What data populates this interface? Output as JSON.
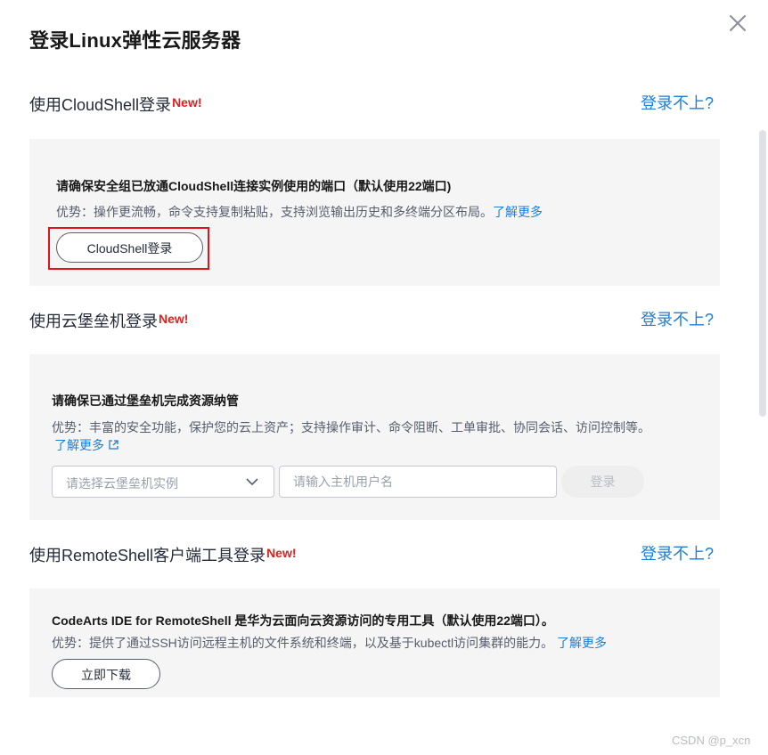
{
  "dialog": {
    "title": "登录Linux弹性云服务器"
  },
  "new_tag": "New!",
  "help_link": "登录不上?",
  "cloudshell": {
    "section_title": "使用CloudShell登录",
    "heading": "请确保安全组已放通CloudShell连接实例使用的端口（默认使用22端口)",
    "desc": "优势：操作更流畅，命令支持复制粘贴，支持浏览输出历史和多终端分区布局。",
    "learn_more": "了解更多",
    "button_label": "CloudShell登录"
  },
  "bastion": {
    "section_title": "使用云堡垒机登录",
    "heading": "请确保已通过堡垒机完成资源纳管",
    "desc": "优势：丰富的安全功能，保护您的云上资产；支持操作审计、命令阻断、工单审批、协同会话、访问控制等。",
    "learn_more": "了解更多",
    "select_placeholder": "请选择云堡垒机实例",
    "input_placeholder": "请输入主机用户名",
    "login_button": "登录"
  },
  "remoteshell": {
    "section_title": "使用RemoteShell客户端工具登录",
    "heading": "CodeArts IDE for RemoteShell 是华为云面向云资源访问的专用工具（默认使用22端口）。",
    "desc": "优势：提供了通过SSH访问远程主机的文件系统和终端，以及基于kubectl访问集群的能力。",
    "learn_more": "了解更多",
    "download_button": "立即下载"
  },
  "watermark": "CSDN @p_xcn",
  "colors": {
    "link": "#1e7fd6",
    "new_tag": "#e02020",
    "highlight": "#e0131b",
    "panel_bg": "#f5f5f6"
  },
  "icons": {
    "close": "close-icon",
    "dropdown": "chevron-down-icon",
    "external": "external-link-icon"
  }
}
